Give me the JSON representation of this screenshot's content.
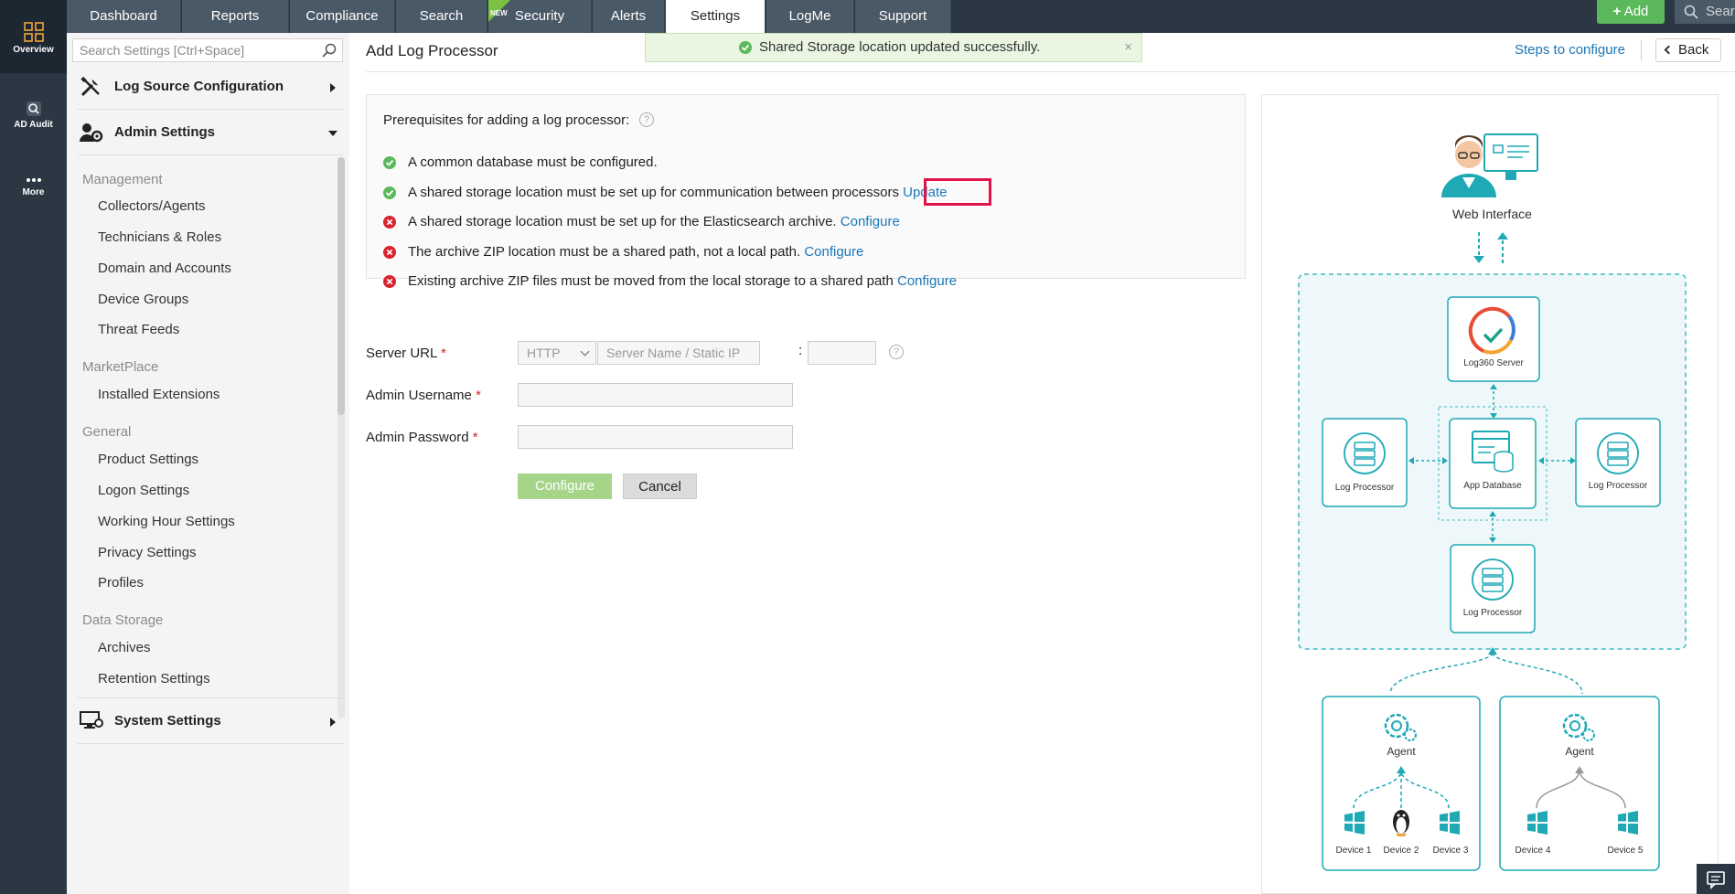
{
  "rail": {
    "overview": "Overview",
    "ad_audit": "AD Audit",
    "more": "More"
  },
  "topnav": {
    "tabs": [
      "Dashboard",
      "Reports",
      "Compliance",
      "Search",
      "Security",
      "Alerts",
      "Settings",
      "LogMe",
      "Support"
    ],
    "active_tab": "Settings",
    "new_badge": "NEW",
    "add_label": "Add",
    "search_placeholder": "Search"
  },
  "sidebar": {
    "search_placeholder": "Search Settings [Ctrl+Space]",
    "log_source": "Log Source Configuration",
    "admin_settings": "Admin Settings",
    "groups": {
      "management": "Management",
      "marketplace": "MarketPlace",
      "general": "General",
      "data_storage": "Data Storage"
    },
    "management_items": [
      "Collectors/Agents",
      "Technicians & Roles",
      "Domain and Accounts",
      "Device Groups",
      "Threat Feeds"
    ],
    "marketplace_items": [
      "Installed Extensions"
    ],
    "general_items": [
      "Product Settings",
      "Logon Settings",
      "Working Hour Settings",
      "Privacy Settings",
      "Profiles"
    ],
    "data_storage_items": [
      "Archives",
      "Retention Settings"
    ],
    "system_settings": "System Settings"
  },
  "main": {
    "title": "Add Log Processor",
    "toast": "Shared Storage location updated successfully.",
    "toast_close": "×",
    "steps_link": "Steps to configure",
    "back_label": "Back",
    "prereq": {
      "title": "Prerequisites for adding a log processor:",
      "help": "?",
      "items": [
        {
          "status": "ok",
          "text": "A common database must be configured.",
          "link": ""
        },
        {
          "status": "ok",
          "text": "A shared storage location must be set up for communication between processors",
          "link": "Update"
        },
        {
          "status": "error",
          "text": "A shared storage location must be set up for the Elasticsearch archive.",
          "link": "Configure"
        },
        {
          "status": "error",
          "text": "The archive ZIP location must be a shared path, not a local path.",
          "link": "Configure"
        },
        {
          "status": "error",
          "text": "Existing archive ZIP files must be moved from the local storage to a shared path",
          "link": "Configure"
        }
      ]
    },
    "form": {
      "server_url_label": "Server URL",
      "protocol_value": "HTTP",
      "server_placeholder": "Server Name / Static IP",
      "port_value": "",
      "port_separator": ":",
      "help": "?",
      "admin_username_label": "Admin Username",
      "admin_username_value": "",
      "admin_password_label": "Admin Password",
      "admin_password_value": "",
      "required_mark": "*",
      "configure_label": "Configure",
      "cancel_label": "Cancel"
    },
    "diagram": {
      "web_interface": "Web Interface",
      "log360_server": "Log360 Server",
      "app_database": "App Database",
      "log_processor": "Log Processor",
      "agent": "Agent",
      "devices": [
        "Device 1",
        "Device 2",
        "Device 3",
        "Device 4",
        "Device 5"
      ]
    }
  },
  "colors": {
    "nav_bg": "#2b3844",
    "accent_link": "#1a77b8",
    "success": "#5cb85c",
    "error": "#d9232e",
    "highlight": "#e2124b",
    "diagram_teal": "#1ea9b5"
  }
}
